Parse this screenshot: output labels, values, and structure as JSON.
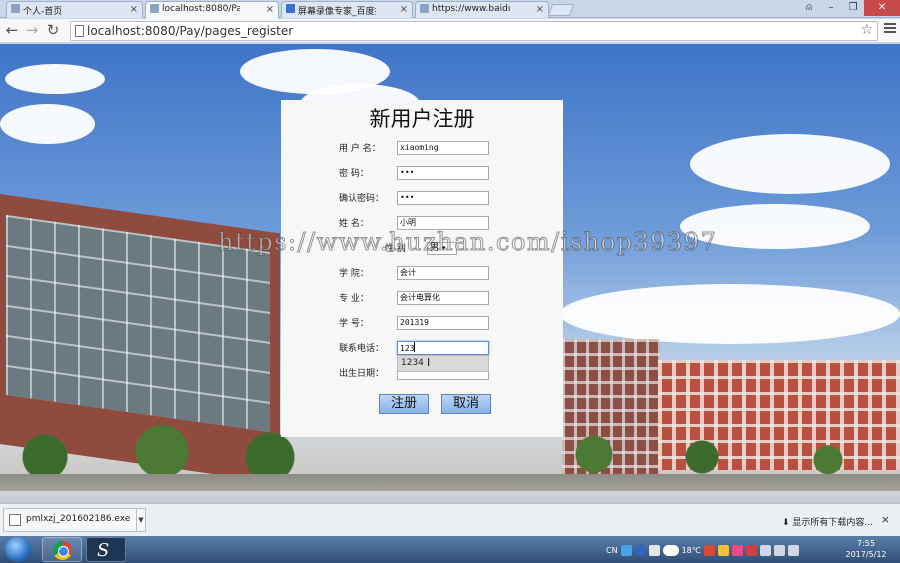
{
  "browser": {
    "tabs": [
      {
        "title": "个人-首页"
      },
      {
        "title": "localhost:8080/Pay/pag"
      },
      {
        "title": "屏幕录像专家_百度搜索"
      },
      {
        "title": "https://www.baidu.com"
      }
    ],
    "url": "localhost:8080/Pay/pages_register"
  },
  "form": {
    "title": "新用户注册",
    "fields": [
      {
        "label": "用 户 名：",
        "value": "xiaoming"
      },
      {
        "label": "密      码：",
        "value": "•••"
      },
      {
        "label": "确认密码：",
        "value": "•••"
      },
      {
        "label": "姓      名：",
        "value": "小明"
      },
      {
        "label": "学      院：",
        "value": "会计"
      },
      {
        "label": "专      业：",
        "value": "会计电算化"
      },
      {
        "label": "学      号：",
        "value": "201319"
      },
      {
        "label": "联系电话：",
        "value": "123"
      },
      {
        "label": "出生日期：",
        "value": ""
      }
    ],
    "gender_label": "性      别",
    "gender_value": "男",
    "autocomplete_suggestion": "1234",
    "submit_label": "注册",
    "cancel_label": "取消"
  },
  "watermark": "https://www.huzhan.com/ishop39397",
  "downloads": {
    "file_name": "pmlxzj_201602186.exe",
    "show_all": "显示所有下载内容..."
  },
  "taskbar": {
    "time": "7:55",
    "date": "2017/5/12",
    "weather": "18℃",
    "lang": "CN"
  }
}
